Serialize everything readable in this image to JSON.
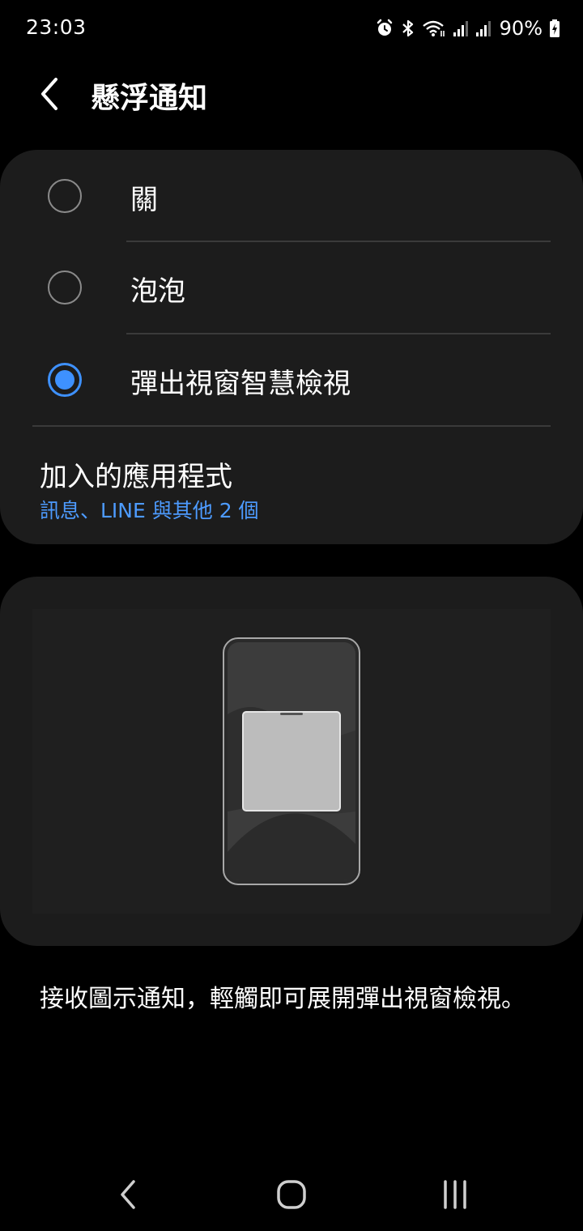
{
  "status_bar": {
    "time": "23:03",
    "battery": "90%",
    "icons": [
      "alarm-icon",
      "bluetooth-icon",
      "wifi-icon",
      "signal-icon",
      "signal-icon",
      "battery-charging-icon"
    ]
  },
  "header": {
    "title": "懸浮通知",
    "back_icon": "back-chevron-icon"
  },
  "options": [
    {
      "label": "關",
      "selected": false
    },
    {
      "label": "泡泡",
      "selected": false
    },
    {
      "label": "彈出視窗智慧檢視",
      "selected": true
    }
  ],
  "apps": {
    "title": "加入的應用程式",
    "subtitle": "訊息、LINE 與其他 2 個"
  },
  "description": "接收圖示通知，輕觸即可展開彈出視窗檢視。",
  "nav": {
    "icons": [
      "nav-back-icon",
      "nav-home-icon",
      "nav-recents-icon"
    ]
  },
  "colors": {
    "accent": "#3e91ff",
    "link": "#4d9bff",
    "card": "#1c1c1c",
    "background": "#000000"
  }
}
